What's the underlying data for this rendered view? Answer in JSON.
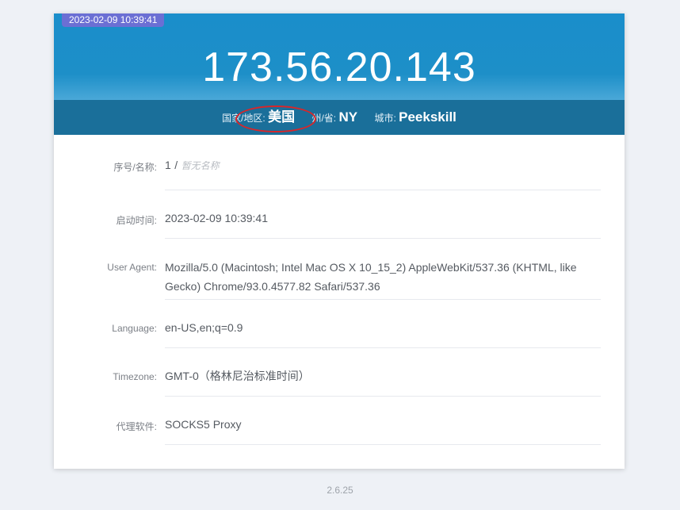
{
  "header": {
    "time_badge": "2023-02-09 10:39:41",
    "ip": "173.56.20.143"
  },
  "geo": {
    "country_label": "国家/地区:",
    "country_value": "美国",
    "state_label": "州/省:",
    "state_value": "NY",
    "city_label": "城市:",
    "city_value": "Peekskill"
  },
  "info": {
    "name_label": "序号/名称:",
    "name_index": "1",
    "name_sep": "/",
    "name_placeholder": "暂无名称",
    "start_label": "启动时间:",
    "start_value": "2023-02-09 10:39:41",
    "ua_label": "User Agent:",
    "ua_value": "Mozilla/5.0 (Macintosh; Intel Mac OS X 10_15_2) AppleWebKit/537.36 (KHTML, like Gecko) Chrome/93.0.4577.82 Safari/537.36",
    "lang_label": "Language:",
    "lang_value": "en-US,en;q=0.9",
    "tz_label": "Timezone:",
    "tz_value": "GMT-0（格林尼治标准时间）",
    "proxy_label": "代理软件:",
    "proxy_value": "SOCKS5 Proxy"
  },
  "footer": {
    "version": "2.6.25"
  },
  "colors": {
    "header_blue": "#1a8ecb",
    "geo_bar": "#1a6f9a",
    "badge": "#6b6fd4",
    "annotation_circle": "#d8262a"
  }
}
